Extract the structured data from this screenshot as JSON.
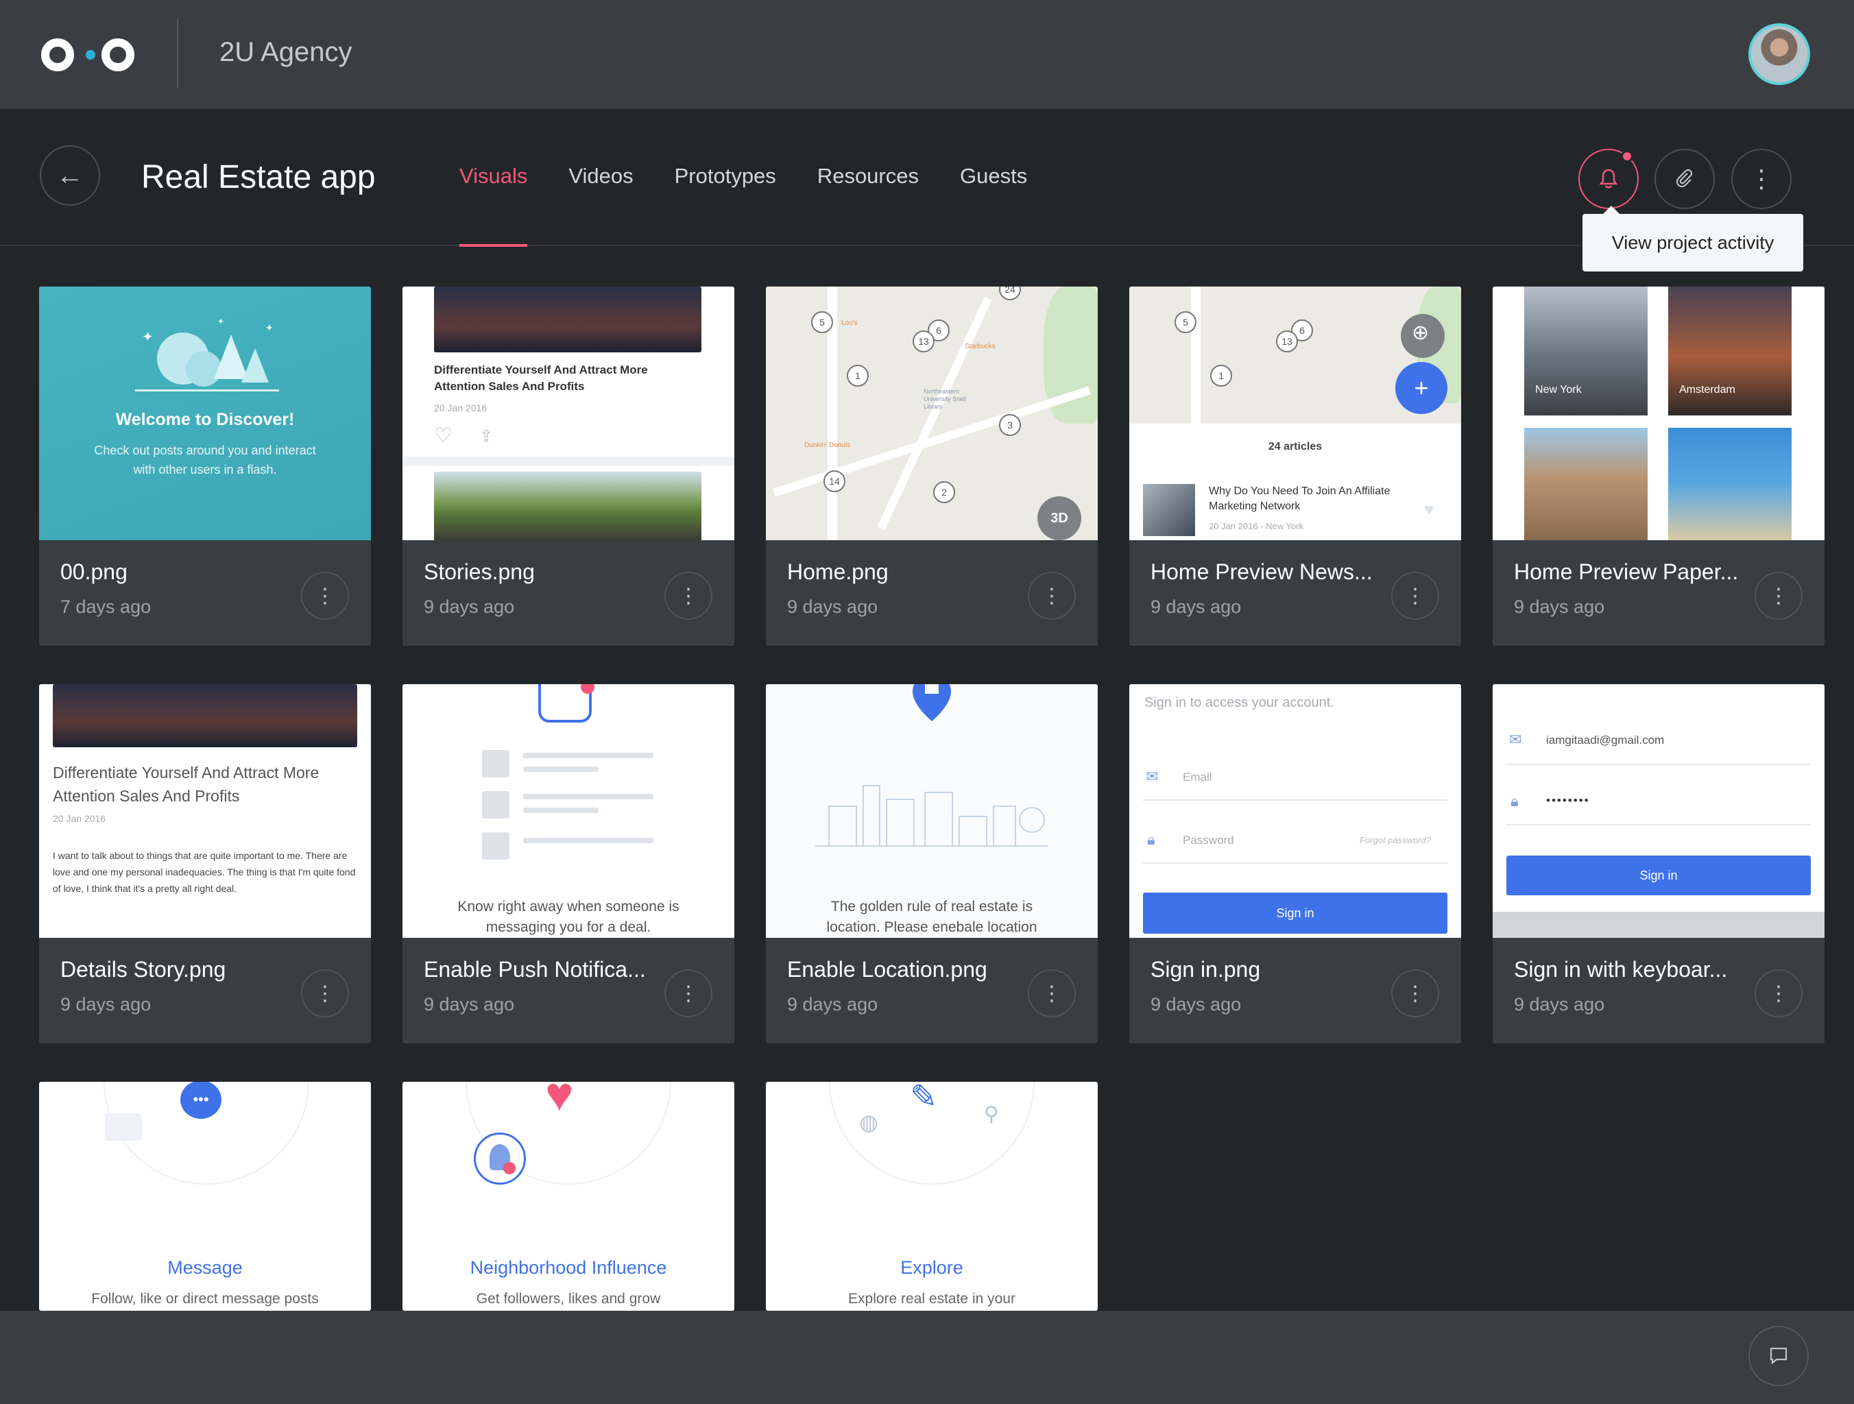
{
  "header": {
    "workspace": "2U Agency",
    "avatar_alt": "user-avatar"
  },
  "project": {
    "title": "Real Estate app",
    "tabs": [
      {
        "label": "Visuals",
        "active": true
      },
      {
        "label": "Videos",
        "active": false
      },
      {
        "label": "Prototypes",
        "active": false
      },
      {
        "label": "Resources",
        "active": false
      },
      {
        "label": "Guests",
        "active": false
      }
    ],
    "tooltip": "View project activity",
    "accent_color": "#f2577a"
  },
  "files": [
    {
      "name": "00.png",
      "date": "7 days ago",
      "thumb": {
        "title": "Welcome to Discover!",
        "text": "Check out posts around you and interact with other users in a flash."
      }
    },
    {
      "name": "Stories.png",
      "date": "9 days ago",
      "thumb": {
        "title": "Differentiate Yourself And Attract More Attention Sales And Profits",
        "date": "20 Jan 2016"
      }
    },
    {
      "name": "Home.png",
      "date": "9 days ago",
      "thumb": {
        "badge": "3D",
        "pins": [
          "5",
          "6",
          "13",
          "1",
          "3",
          "2",
          "14",
          "24"
        ],
        "places": [
          "Lou's",
          "Starbucks",
          "Northeastern University Snell Library",
          "Dunkin' Donuts"
        ]
      }
    },
    {
      "name": "Home Preview News...",
      "date": "9 days ago",
      "thumb": {
        "count": "24 articles",
        "title": "Why Do You Need To Join An Affiliate Marketing Network",
        "meta": "20 Jan 2016 - New York"
      }
    },
    {
      "name": "Home Preview Paper...",
      "date": "9 days ago",
      "thumb": {
        "cities": [
          "New York",
          "Amsterdam"
        ]
      }
    },
    {
      "name": "Details Story.png",
      "date": "9 days ago",
      "thumb": {
        "title": "Differentiate Yourself And Attract More Attention Sales And Profits",
        "date": "20 Jan 2016",
        "body": "I want to talk about to things that are quite important to me. There are love and one my personal inadequacies. The thing is that I'm quite fond of love, I think that it's a pretty all right deal."
      }
    },
    {
      "name": "Enable Push Notifica...",
      "date": "9 days ago",
      "thumb": {
        "text": "Know right away when someone is messaging you for a deal."
      }
    },
    {
      "name": "Enable Location.png",
      "date": "9 days ago",
      "thumb": {
        "text": "The golden rule of real estate is location. Please enebale location"
      }
    },
    {
      "name": "Sign in.png",
      "date": "9 days ago",
      "thumb": {
        "heading": "Sign in to access your account.",
        "email_placeholder": "Email",
        "password_placeholder": "Password",
        "forgot": "Forgot password?",
        "button": "Sign in"
      }
    },
    {
      "name": "Sign in with keyboar...",
      "date": "9 days ago",
      "thumb": {
        "email": "iamgitaadi@gmail.com",
        "password": "••••••••",
        "button": "Sign in"
      }
    },
    {
      "thumb": {
        "title": "Message",
        "text": "Follow, like or direct message posts"
      }
    },
    {
      "thumb": {
        "title": "Neighborhood Influence",
        "text": "Get followers, likes and grow"
      }
    },
    {
      "thumb": {
        "title": "Explore",
        "text": "Explore real estate in your"
      }
    }
  ]
}
